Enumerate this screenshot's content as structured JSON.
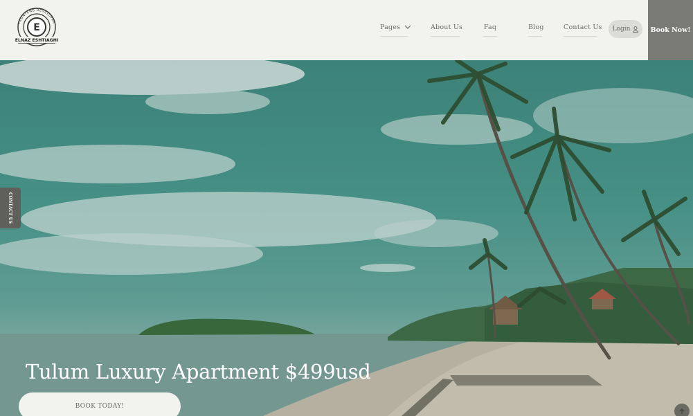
{
  "brand": {
    "logo_letter": "E",
    "logo_top_text": "FRONTEND DEVELOPER",
    "logo_bottom_text": "ELNAZ ESHTIAGHI"
  },
  "nav": {
    "items": [
      {
        "label": "Pages",
        "icon": "chevron-down-icon"
      },
      {
        "label": "About Us"
      },
      {
        "label": "Faq"
      },
      {
        "label": "Blog"
      },
      {
        "label": "Contact Us"
      }
    ],
    "login_label": "Login",
    "login_icon": "user-icon",
    "book_now_label": "Book Now!"
  },
  "hero": {
    "title": "Tulum Luxury Apartment $499usd",
    "cta_label": "BOOK TODAY!",
    "contact_tab_label": "CONTACT US"
  },
  "colors": {
    "header_bg": "#f2f2ee",
    "book_now_bg": "#7a7a77",
    "sky": "#4a9a8f",
    "contact_tab_bg": "#5f5f5c"
  }
}
